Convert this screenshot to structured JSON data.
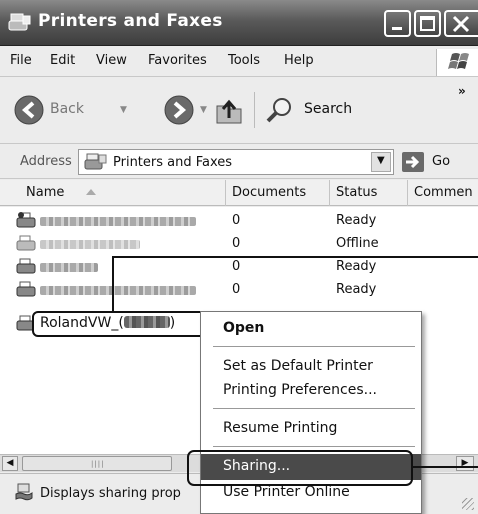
{
  "window": {
    "title": "Printers and Faxes"
  },
  "menubar": {
    "items": [
      "File",
      "Edit",
      "View",
      "Favorites",
      "Tools",
      "Help"
    ]
  },
  "toolbar": {
    "back_label": "Back",
    "search_label": "Search",
    "overflow_label": "»"
  },
  "addressbar": {
    "label": "Address",
    "value": "Printers and Faxes",
    "go_label": "Go"
  },
  "columns": {
    "name": "Name",
    "documents": "Documents",
    "status": "Status",
    "comments": "Commen"
  },
  "printers": [
    {
      "documents": "0",
      "status": "Ready"
    },
    {
      "documents": "0",
      "status": "Offline"
    },
    {
      "documents": "0",
      "status": "Ready"
    },
    {
      "documents": "0",
      "status": "Ready"
    }
  ],
  "selected_printer": {
    "name_prefix": "RolandVW_(",
    "name_suffix": ")"
  },
  "context_menu": {
    "open": "Open",
    "set_default": "Set as Default Printer",
    "preferences": "Printing Preferences...",
    "resume": "Resume Printing",
    "sharing": "Sharing...",
    "use_online": "Use Printer Online"
  },
  "statusbar": {
    "text": "Displays sharing prop"
  },
  "colors": {
    "titlebar": "#5a5a5a",
    "highlight": "#4a4a4a"
  }
}
